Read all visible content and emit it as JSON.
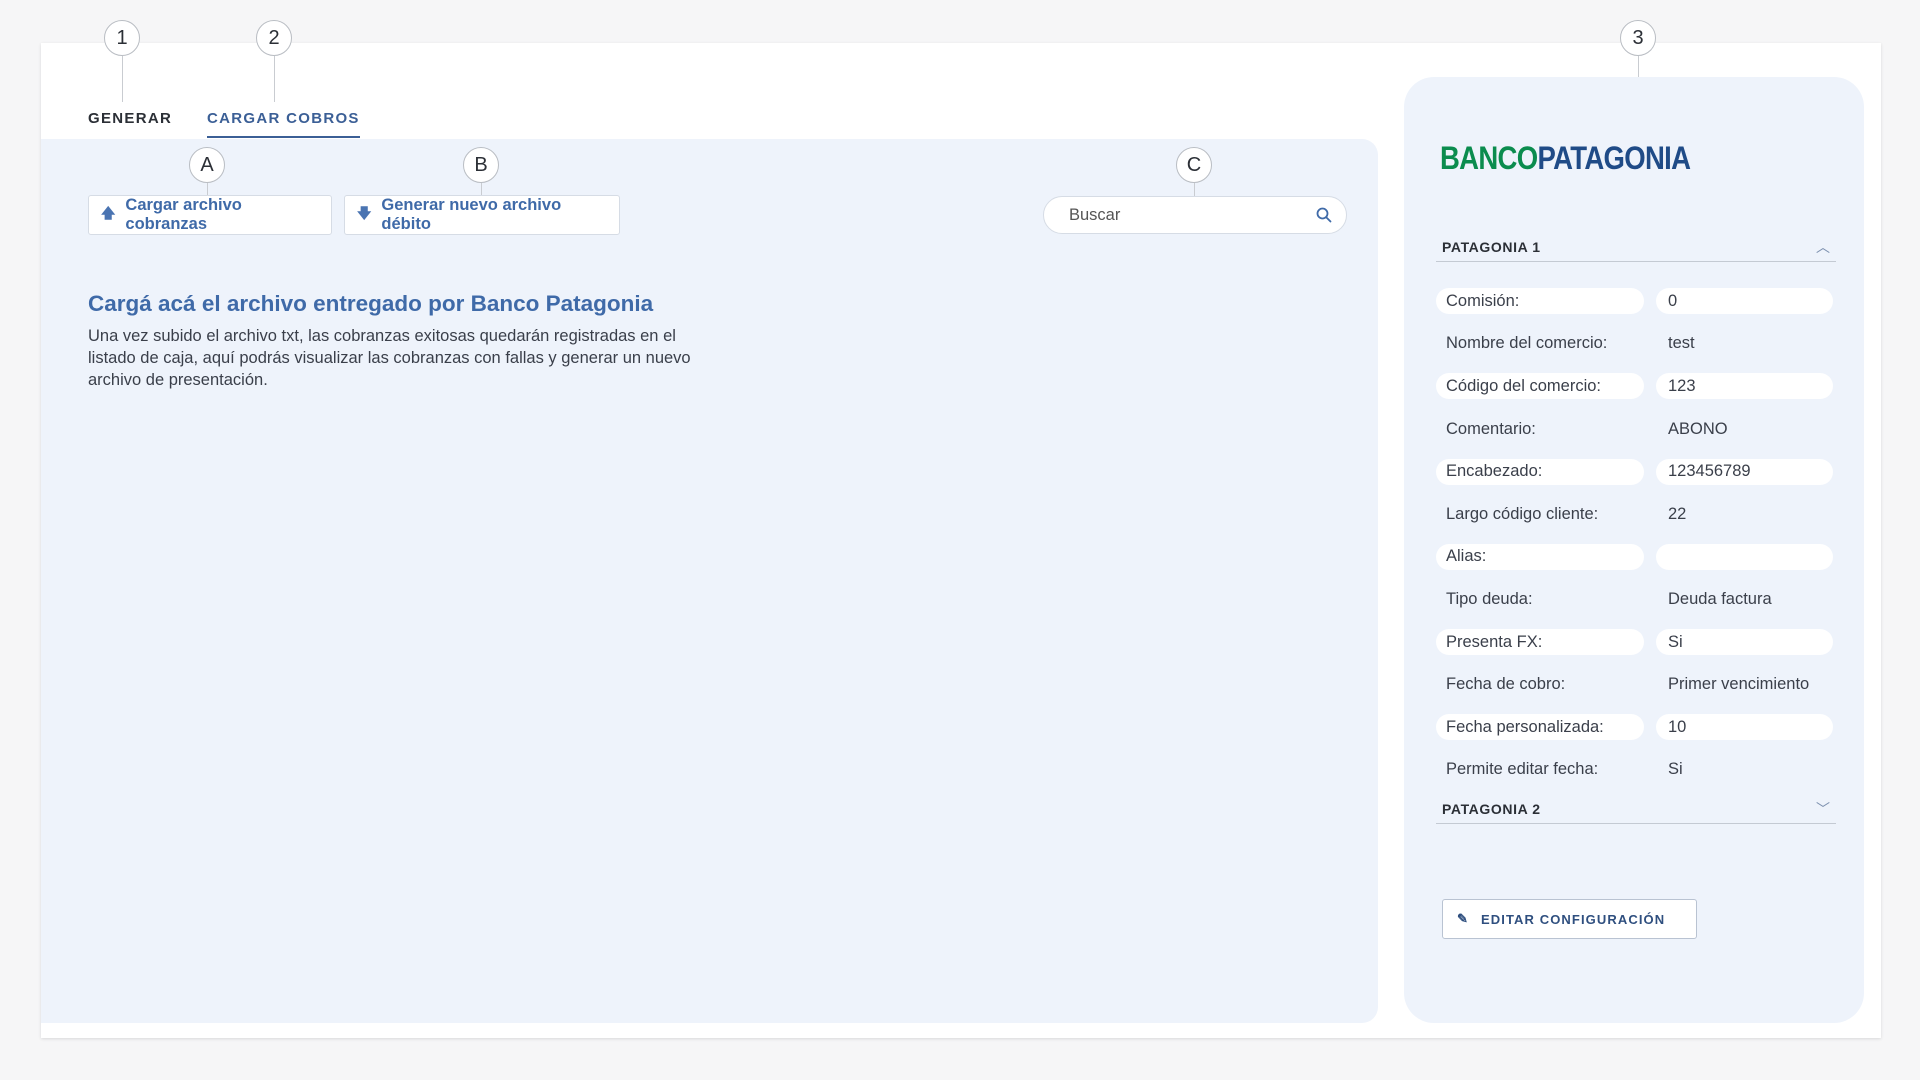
{
  "callouts": {
    "c1": "1",
    "c2": "2",
    "c3": "3",
    "cA": "A",
    "cB": "B",
    "cC": "C"
  },
  "tabs": {
    "generar": "GENERAR",
    "cargar_cobros": "CARGAR COBROS"
  },
  "toolbar": {
    "upload_label": "Cargar archivo cobranzas",
    "generate_label": "Generar nuevo archivo débito",
    "search_placeholder": "Buscar"
  },
  "intro": {
    "title": "Cargá acá el archivo entregado por Banco Patagonia",
    "text": "Una vez subido el archivo txt, las cobranzas exitosas quedarán registradas en el listado de caja, aquí podrás visualizar las cobranzas con fallas y generar un nuevo archivo de presentación."
  },
  "sidebar": {
    "logo_part1": "BANCO",
    "logo_part2": "PATAGONIA",
    "section1_title": "PATAGONIA 1",
    "section2_title": "PATAGONIA 2",
    "rows": [
      {
        "label": "Comisión:",
        "value": "0"
      },
      {
        "label": "Nombre del comercio:",
        "value": "test"
      },
      {
        "label": "Código del comercio:",
        "value": "123"
      },
      {
        "label": "Comentario:",
        "value": "ABONO"
      },
      {
        "label": "Encabezado:",
        "value": "123456789"
      },
      {
        "label": "Largo código cliente:",
        "value": "22"
      },
      {
        "label": "Alias:",
        "value": ""
      },
      {
        "label": "Tipo deuda:",
        "value": "Deuda factura"
      },
      {
        "label": "Presenta FX:",
        "value": "Si"
      },
      {
        "label": "Fecha de cobro:",
        "value": "Primer vencimiento"
      },
      {
        "label": "Fecha personalizada:",
        "value": "10"
      },
      {
        "label": "Permite editar fecha:",
        "value": "Si"
      }
    ],
    "edit_label": "EDITAR CONFIGURACIÓN"
  },
  "colors": {
    "accent": "#3f6aa8",
    "panel_bg": "#eef3fb",
    "logo_green": "#0b8c4e",
    "logo_blue": "#1f4b87"
  }
}
